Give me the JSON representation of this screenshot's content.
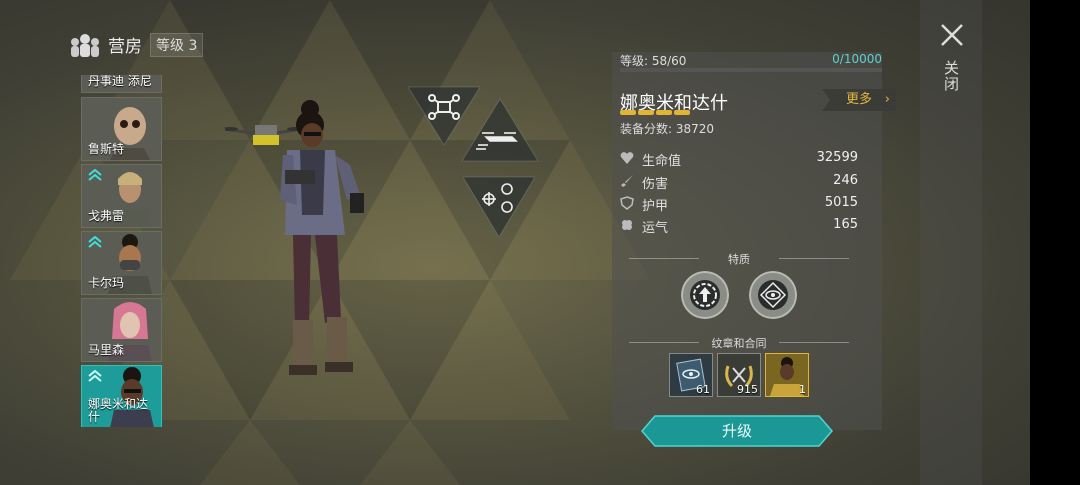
{
  "header": {
    "title": "营房",
    "level_label": "等级 3"
  },
  "roster": [
    {
      "name": "丹事迪 添尼",
      "selected": false,
      "upgradable": false
    },
    {
      "name": "鲁斯特",
      "selected": false,
      "upgradable": false
    },
    {
      "name": "戈弗雷",
      "selected": false,
      "upgradable": true
    },
    {
      "name": "卡尔玛",
      "selected": false,
      "upgradable": true
    },
    {
      "name": "马里森",
      "selected": false,
      "upgradable": false
    },
    {
      "name": "娜奥米和达什",
      "selected": true,
      "upgradable": true
    }
  ],
  "skills": {
    "drone_icon": "drone-icon",
    "flight_icon": "drone-flight-icon",
    "target_icon": "drone-target-icon"
  },
  "hero": {
    "level_text": "等级: 58/60",
    "xp_text": "0/10000",
    "xp_progress": 0,
    "name": "娜奥米和达什",
    "stars": 4,
    "gear_score": "装备分数: 38720",
    "more_label": "更多"
  },
  "stats": [
    {
      "icon": "heart-icon",
      "label": "生命值",
      "value": "32599"
    },
    {
      "icon": "sword-icon",
      "label": "伤害",
      "value": "246"
    },
    {
      "icon": "shield-icon",
      "label": "护甲",
      "value": "5015"
    },
    {
      "icon": "clover-icon",
      "label": "运气",
      "value": "165"
    }
  ],
  "traits": {
    "title": "特质"
  },
  "badges": {
    "title": "纹章和合同",
    "items": [
      {
        "icon": "eye-emblem-icon",
        "count": "61"
      },
      {
        "icon": "laurel-emblem-icon",
        "count": "915"
      },
      {
        "icon": "hero-contract-icon",
        "count": "1"
      }
    ]
  },
  "upgrade_label": "升级",
  "close_label": "关闭",
  "colors": {
    "accent": "#1e9c9a",
    "gold": "#e1b433",
    "xp": "#5ed0d0"
  }
}
